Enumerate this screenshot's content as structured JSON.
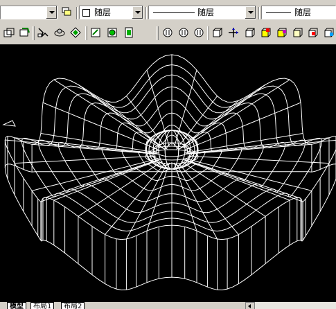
{
  "properties_toolbar": {
    "color_combo": {
      "value": "随层"
    },
    "linetype_combo": {
      "value": "随层"
    },
    "lineweight_combo": {
      "value": "随层"
    }
  },
  "toolbar_icons": [
    "layer-manager-icon",
    "make-layer-current-icon",
    "match-properties-icon",
    "orbit-icon",
    "shade-icon",
    "edit-icon",
    "render-icon",
    "material-icon",
    "zoom-realtime-icon",
    "zoom-window-icon",
    "zoom-previous-icon",
    "ucs-icon",
    "move-3d-icon",
    "box-icon",
    "wedge-icon",
    "cone-icon",
    "sphere-icon",
    "cylinder-icon"
  ],
  "drawing": {
    "background": "#000000",
    "wire_color": "#ffffff"
  },
  "layout_tabs": [
    {
      "label": "模型",
      "active": true
    },
    {
      "label": "布局1",
      "active": false
    },
    {
      "label": "布局2",
      "active": false
    }
  ]
}
